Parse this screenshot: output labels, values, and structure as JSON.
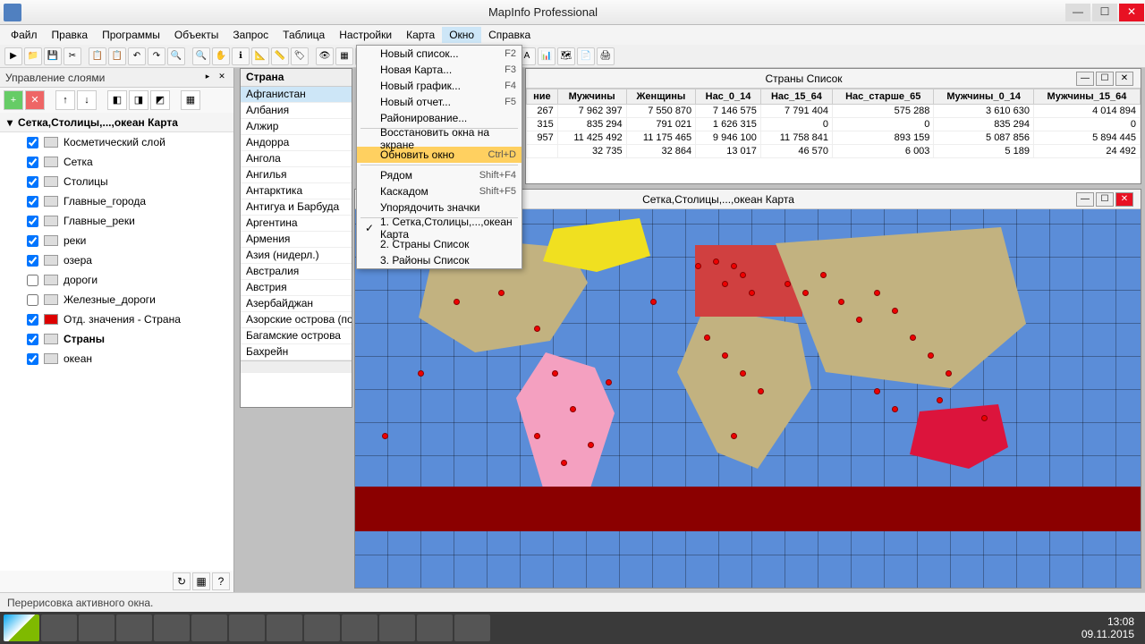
{
  "titlebar": {
    "title": "MapInfo Professional"
  },
  "menu": {
    "items": [
      "Файл",
      "Правка",
      "Программы",
      "Объекты",
      "Запрос",
      "Таблица",
      "Настройки",
      "Карта",
      "Окно",
      "Справка"
    ],
    "open": 8
  },
  "dropdown": {
    "items": [
      {
        "label": "Новый список...",
        "shortcut": "F2"
      },
      {
        "label": "Новая Карта...",
        "shortcut": "F3"
      },
      {
        "label": "Новый график...",
        "shortcut": "F4"
      },
      {
        "label": "Новый отчет...",
        "shortcut": "F5"
      },
      {
        "label": "Районирование...",
        "shortcut": ""
      },
      {
        "sep": true
      },
      {
        "label": "Восстановить окна на экране",
        "shortcut": ""
      },
      {
        "label": "Обновить окно",
        "shortcut": "Ctrl+D",
        "highlight": true
      },
      {
        "sep": true
      },
      {
        "label": "Рядом",
        "shortcut": "Shift+F4"
      },
      {
        "label": "Каскадом",
        "shortcut": "Shift+F5"
      },
      {
        "label": "Упорядочить значки",
        "shortcut": ""
      },
      {
        "sep": true
      },
      {
        "label": "1. Сетка,Столицы,...,океан Карта",
        "shortcut": "",
        "checked": true
      },
      {
        "label": "2. Страны Список",
        "shortcut": ""
      },
      {
        "label": "3. Районы Список",
        "shortcut": ""
      }
    ]
  },
  "panel": {
    "title": "Управление слоями",
    "layer_group": "Сетка,Столицы,...,океан Карта",
    "layers": [
      {
        "name": "Косметический слой",
        "checked": true
      },
      {
        "name": "Сетка",
        "checked": true
      },
      {
        "name": "Столицы",
        "checked": true
      },
      {
        "name": "Главные_города",
        "checked": true
      },
      {
        "name": "Главные_реки",
        "checked": true
      },
      {
        "name": "реки",
        "checked": true
      },
      {
        "name": "озера",
        "checked": true
      },
      {
        "name": "дороги",
        "checked": false
      },
      {
        "name": "Железные_дороги",
        "checked": false
      },
      {
        "name": "Отд. значения - Страна",
        "checked": true,
        "red": true
      },
      {
        "name": "Страны",
        "checked": true,
        "bold": true
      },
      {
        "name": "океан",
        "checked": true
      }
    ]
  },
  "countrylist": {
    "header": "Страна",
    "rows": [
      "Афганистан",
      "Албания",
      "Алжир",
      "Андорра",
      "Ангола",
      "Ангилья",
      "Антарктика",
      "Антигуа и Барбуда",
      "Аргентина",
      "Армения",
      "Азия (нидерл.)",
      "Австралия",
      "Австрия",
      "Азербайджан",
      "Азорские острова (пор",
      "Багамские острова",
      "Бахрейн"
    ],
    "selected": 0
  },
  "table": {
    "title": "Страны Список",
    "headers": [
      "ние",
      "Мужчины",
      "Женщины",
      "Нас_0_14",
      "Нас_15_64",
      "Нас_старше_65",
      "Мужчины_0_14",
      "Мужчины_15_64"
    ],
    "rows": [
      [
        "267",
        "7 962 397",
        "7 550 870",
        "7 146 575",
        "7 791 404",
        "575 288",
        "3 610 630",
        "4 014 894"
      ],
      [
        "315",
        "835 294",
        "791 021",
        "1 626 315",
        "0",
        "0",
        "835 294",
        "0"
      ],
      [
        "957",
        "11 425 492",
        "11 175 465",
        "9 946 100",
        "11 758 841",
        "893 159",
        "5 087 856",
        "5 894 445"
      ],
      [
        "",
        "32 735",
        "32 864",
        "13 017",
        "46 570",
        "6 003",
        "5 189",
        "24 492"
      ]
    ]
  },
  "map": {
    "title": "Сетка,Столицы,...,океан Карта"
  },
  "status": {
    "text": "Перерисовка активного окна."
  },
  "clock": {
    "time": "13:08",
    "date": "09.11.2015"
  }
}
